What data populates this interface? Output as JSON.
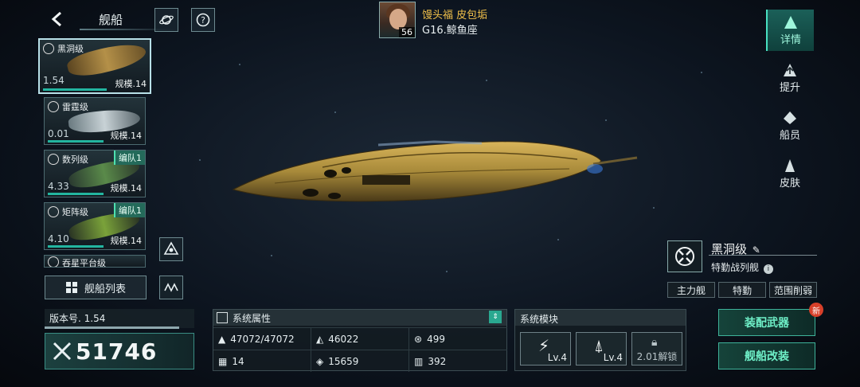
{
  "header": {
    "title": "舰船",
    "back_icon": "back-arrow-icon"
  },
  "commander": {
    "name": "馒头福 皮包垢",
    "level": "56",
    "location": "G16.鲸鱼座"
  },
  "ship_list": [
    {
      "name": "黑洞级",
      "value": "1.54",
      "scale": "规模.14",
      "team": ""
    },
    {
      "name": "雷霆级",
      "value": "0.01",
      "scale": "规模.14",
      "team": ""
    },
    {
      "name": "数列级",
      "value": "4.33",
      "scale": "规模.14",
      "team": "编队1"
    },
    {
      "name": "矩阵级",
      "value": "4.10",
      "scale": "规模.14",
      "team": "编队1"
    },
    {
      "name": "吞星平台级",
      "value": "",
      "scale": "",
      "team": ""
    }
  ],
  "fleet_list_label": "舰船列表",
  "version": {
    "label": "版本号. 1.54",
    "progress": 0.9
  },
  "power": "51746",
  "attributes": {
    "title": "系统属性",
    "items": [
      "47072/47072",
      "46022",
      "499",
      "14",
      "15659",
      "392"
    ]
  },
  "modules": {
    "title": "系统模块",
    "slots": [
      {
        "level": "Lv.4"
      },
      {
        "level": "Lv.4"
      },
      {
        "unlock": "2.01解锁"
      }
    ]
  },
  "actions": {
    "equip": "装配武器",
    "modify": "舰船改装",
    "new_badge": "新"
  },
  "right_tabs": [
    "详情",
    "提升",
    "船员",
    "皮肤"
  ],
  "ship_info": {
    "name": "黑洞级",
    "class": "特勤战列舰",
    "tags": [
      "主力舰",
      "特勤",
      "范围削弱"
    ]
  },
  "colors": {
    "accent": "#48e0c0",
    "gold": "#f2c14a",
    "hull": "#a88a3a"
  }
}
